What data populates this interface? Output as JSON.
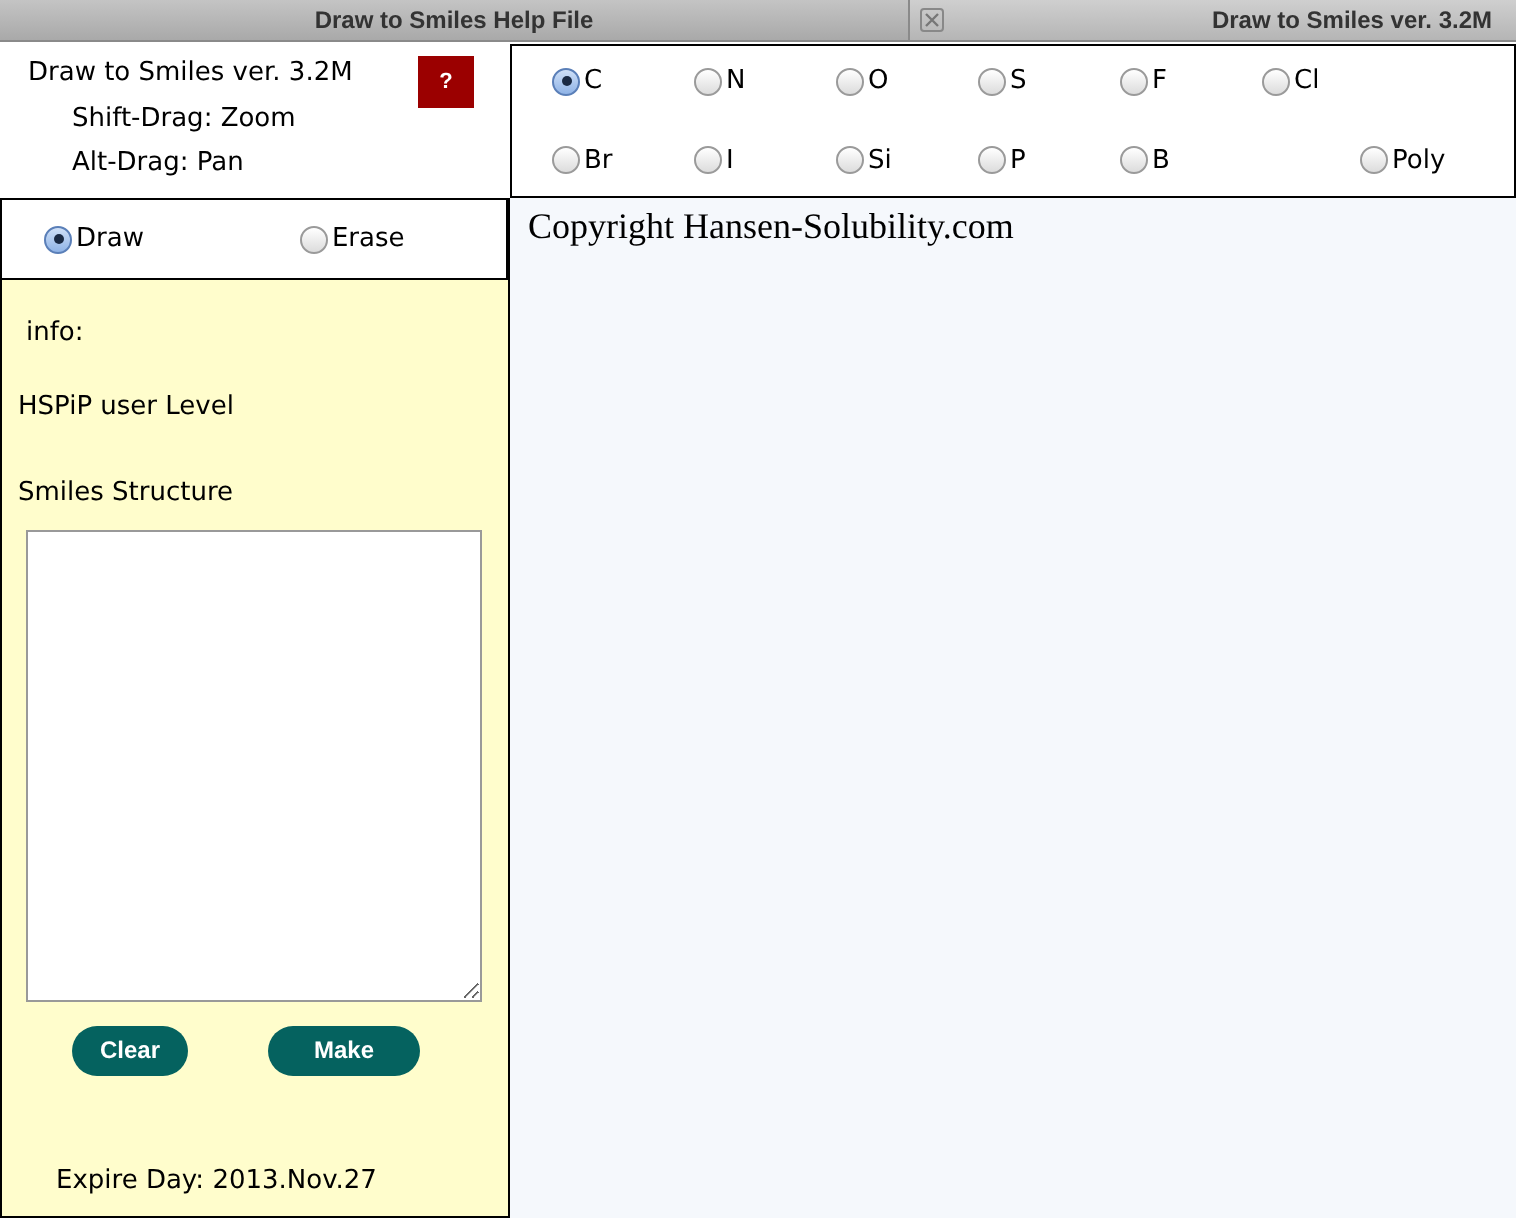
{
  "tabs": [
    {
      "title": "Draw to Smiles Help File",
      "selected": false,
      "closable": false
    },
    {
      "title": "Draw to Smiles ver. 3.2M",
      "selected": true,
      "closable": true
    }
  ],
  "header": {
    "title": "Draw to Smiles ver. 3.2M",
    "help_button": "?",
    "hints": [
      "Shift-Drag: Zoom",
      "Alt-Drag: Pan"
    ]
  },
  "elements": [
    [
      {
        "label": "C",
        "selected": true
      },
      {
        "label": "N",
        "selected": false
      },
      {
        "label": "O",
        "selected": false
      },
      {
        "label": "S",
        "selected": false
      },
      {
        "label": "F",
        "selected": false
      },
      {
        "label": "Cl",
        "selected": false
      }
    ],
    [
      {
        "label": "Br",
        "selected": false
      },
      {
        "label": "I",
        "selected": false
      },
      {
        "label": "Si",
        "selected": false
      },
      {
        "label": "P",
        "selected": false
      },
      {
        "label": "B",
        "selected": false
      },
      {
        "label": "Poly",
        "selected": false
      }
    ]
  ],
  "modes": [
    {
      "label": "Draw",
      "selected": true
    },
    {
      "label": "Erase",
      "selected": false
    }
  ],
  "info_label": "info:",
  "user_level": "HSPiP user Level",
  "smiles_label": "Smiles Structure",
  "buttons": [
    "Clear",
    "Make"
  ],
  "expire": "Expire Day: 2013.Nov.27",
  "copyright": "Copyright Hansen-Solubility.com"
}
